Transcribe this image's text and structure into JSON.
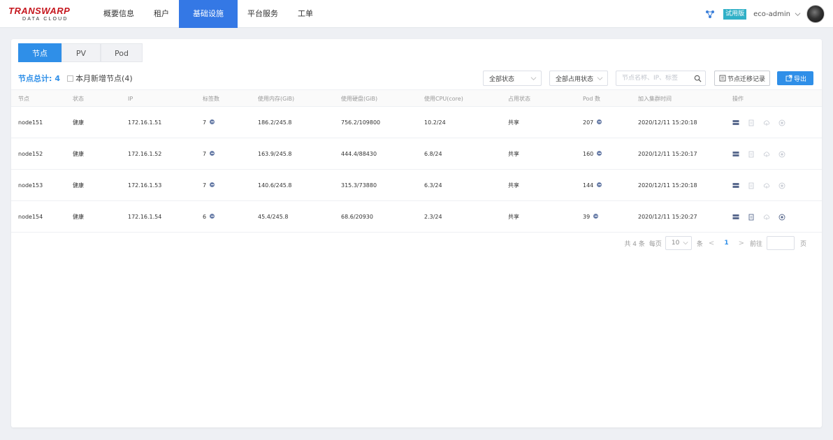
{
  "brand": {
    "name": "TRANSWARP",
    "tagline": "DATA CLOUD",
    "color": "#c5161d"
  },
  "nav": {
    "items": [
      {
        "label": "概要信息",
        "active": false
      },
      {
        "label": "租户",
        "active": false
      },
      {
        "label": "基础设施",
        "active": true
      },
      {
        "label": "平台服务",
        "active": false
      },
      {
        "label": "工单",
        "active": false
      }
    ],
    "accent": "#3478e5"
  },
  "user": {
    "badge": "试用版",
    "name": "eco-admin",
    "icons": [
      "share-network-icon",
      "chevron-down-icon",
      "avatar"
    ]
  },
  "tabs": [
    {
      "label": "节点",
      "active": true
    },
    {
      "label": "PV",
      "active": false
    },
    {
      "label": "Pod",
      "active": false
    }
  ],
  "summary": {
    "label": "节点总计:",
    "count": "4",
    "checkbox_label": "本月新增节点(4)",
    "checked": false
  },
  "filters": {
    "status_select": "全部状态",
    "occupy_select": "全部占用状态",
    "search_placeholder": "节点名称、IP、标签",
    "migration_button": "节点迁移记录",
    "export_button": "导出"
  },
  "table": {
    "columns": [
      "节点",
      "状态",
      "IP",
      "标签数",
      "使用内存(GiB)",
      "使用硬盘(GiB)",
      "使用CPU(core)",
      "占用状态",
      "Pod 数",
      "加入集群时间",
      "操作"
    ],
    "rows": [
      {
        "node": "node151",
        "status": "健康",
        "ip": "172.16.1.51",
        "labels": "7",
        "memory": "186.2/245.8",
        "disk": "756.2/109800",
        "cpu": "10.2/24",
        "occupy": "共享",
        "pods": "207",
        "joined": "2020/12/11 15:20:18"
      },
      {
        "node": "node152",
        "status": "健康",
        "ip": "172.16.1.52",
        "labels": "7",
        "memory": "163.9/245.8",
        "disk": "444.4/88430",
        "cpu": "6.8/24",
        "occupy": "共享",
        "pods": "160",
        "joined": "2020/12/11 15:20:17"
      },
      {
        "node": "node153",
        "status": "健康",
        "ip": "172.16.1.53",
        "labels": "7",
        "memory": "140.6/245.8",
        "disk": "315.3/73880",
        "cpu": "6.3/24",
        "occupy": "共享",
        "pods": "144",
        "joined": "2020/12/11 15:20:18"
      },
      {
        "node": "node154",
        "status": "健康",
        "ip": "172.16.1.54",
        "labels": "6",
        "memory": "45.4/245.8",
        "disk": "68.6/20930",
        "cpu": "2.3/24",
        "occupy": "共享",
        "pods": "39",
        "joined": "2020/12/11 15:20:27"
      }
    ],
    "row_actions": [
      "server-icon",
      "copy-doc-icon",
      "cloud-upload-icon",
      "stop-circle-icon"
    ]
  },
  "pagination": {
    "total_text": "共 4 条",
    "per_page_label": "每页",
    "per_page_value": "10",
    "per_page_unit": "条",
    "prev": "<",
    "current": "1",
    "next": ">",
    "goto_label": "前往",
    "page_unit": "页"
  }
}
